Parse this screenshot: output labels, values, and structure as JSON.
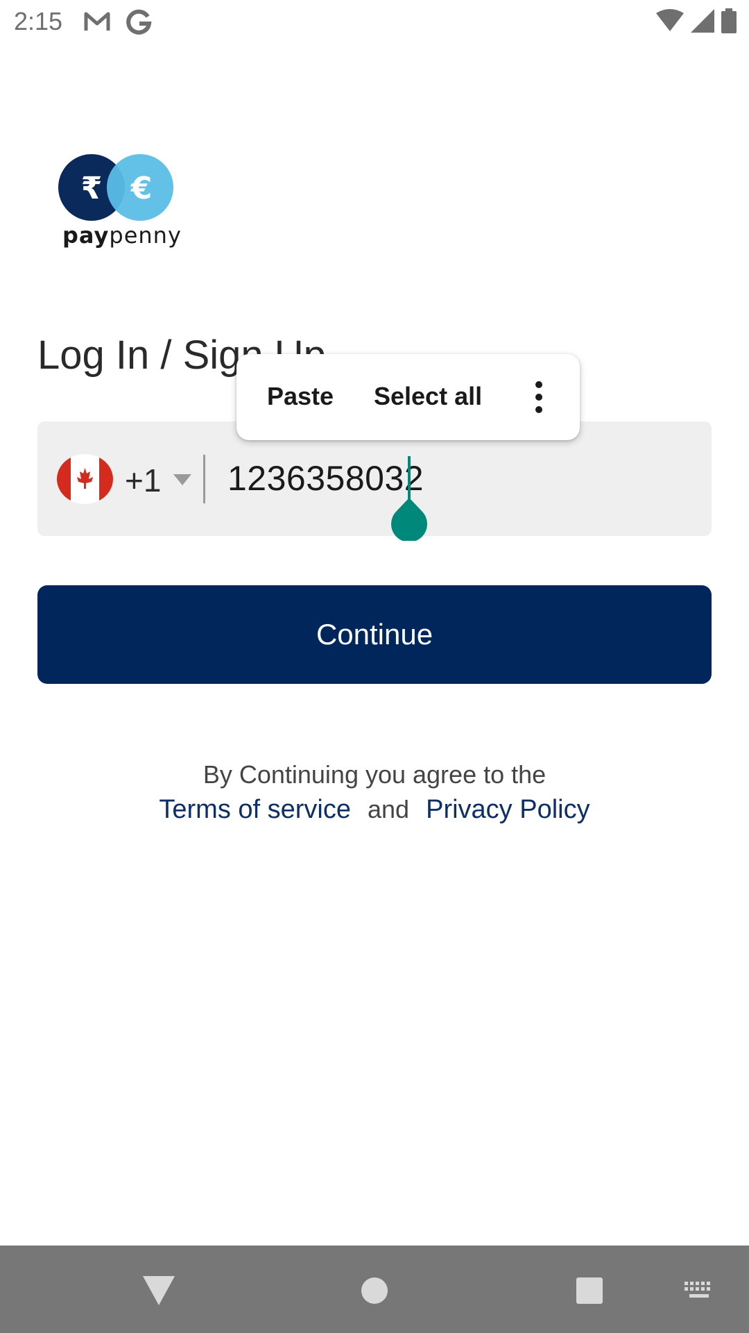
{
  "status_bar": {
    "time": "2:15",
    "left_icons": [
      "gmail-icon",
      "google-icon"
    ],
    "right_icons": [
      "wifi-icon",
      "cell-signal-icon",
      "battery-icon"
    ]
  },
  "logo": {
    "text_bold": "pay",
    "text_regular": "penny",
    "rupee_symbol": "₹",
    "euro_symbol": "€",
    "colors": {
      "dark": "#0b2a5c",
      "light": "#5bbde6"
    }
  },
  "title": "Log In / Sign Up",
  "phone_field": {
    "country_flag": "canada-flag-icon",
    "dial_code": "+1",
    "value": "1236358032"
  },
  "context_menu": {
    "paste_label": "Paste",
    "select_all_label": "Select all",
    "more_icon": "more-vertical-icon"
  },
  "continue_button": {
    "label": "Continue",
    "color": "#00265b"
  },
  "terms": {
    "line1": "By Continuing you agree to the",
    "terms_link": "Terms of service",
    "and": "and",
    "privacy_link": "Privacy Policy",
    "link_color": "#0d2f66"
  },
  "nav_bar": {
    "icons": [
      "back-icon",
      "home-icon",
      "recents-icon",
      "keyboard-icon"
    ]
  },
  "colors": {
    "accent_cursor": "#00897b",
    "field_bg": "#efefef"
  }
}
